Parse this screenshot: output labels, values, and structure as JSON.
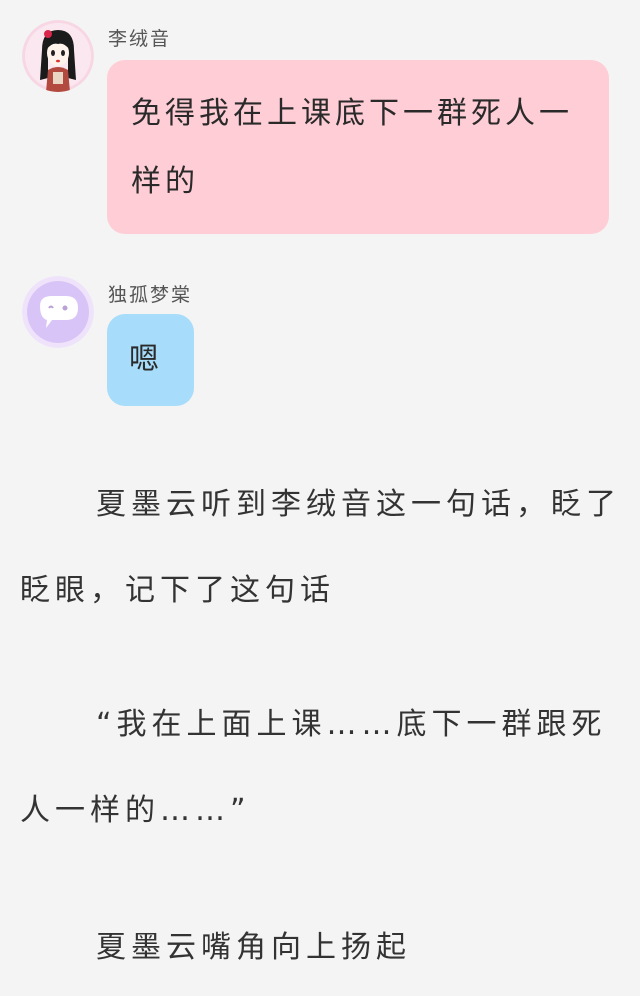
{
  "messages": [
    {
      "sender": "李绒音",
      "text": "免得我在上课底下一群死人一样的"
    },
    {
      "sender": "独孤梦棠",
      "text": "嗯"
    }
  ],
  "paragraphs": [
    "夏墨云听到李绒音这一句话，眨了眨眼，记下了这句话",
    "“我在上面上课……底下一群跟死人一样的……”",
    "夏墨云嘴角向上扬起"
  ],
  "colors": {
    "background": "#f4f4f4",
    "bubble_pink": "#ffcdd6",
    "bubble_blue": "#a7dcfb",
    "avatar_purple": "#d9c4f7"
  }
}
